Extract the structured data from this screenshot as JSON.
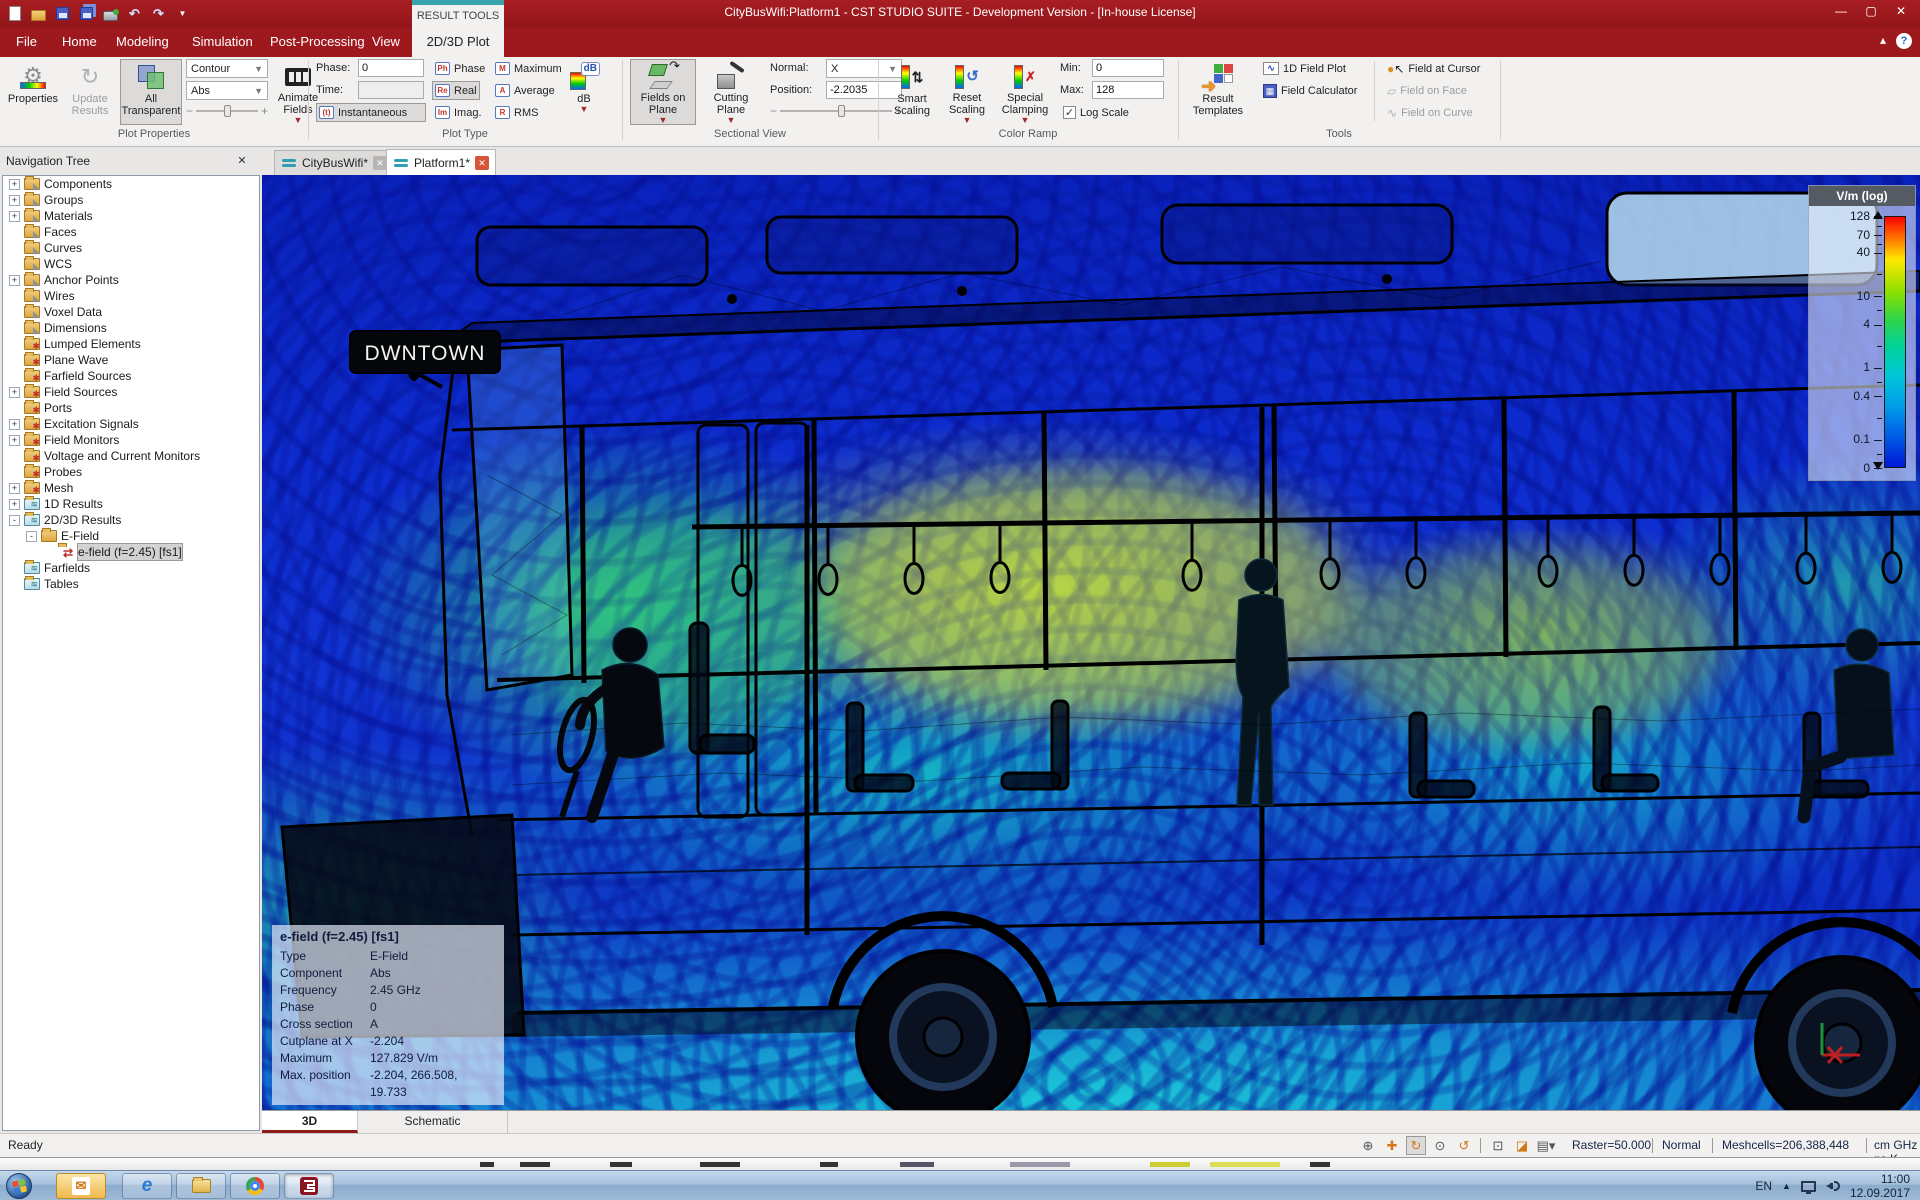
{
  "title_bar": {
    "title": "CityBusWifi:Platform1 - CST STUDIO SUITE - Development Version - [In-house License]",
    "contextual_group": "RESULT TOOLS"
  },
  "ribbon": {
    "tabs": [
      "File",
      "Home",
      "Modeling",
      "Simulation",
      "Post-Processing",
      "View"
    ],
    "contextual_tab": "2D/3D Plot",
    "plot_properties": {
      "label": "Plot Properties",
      "properties": "Properties",
      "update_results": "Update Results",
      "all_transparent": "All Transparent",
      "plot_type_value": "Contour",
      "component_value": "Abs",
      "animate_fields": "Animate Fields"
    },
    "plot_type": {
      "label": "Plot Type",
      "phase_label": "Phase:",
      "phase_value": "0",
      "time_label": "Time:",
      "time_value": "",
      "instantaneous": "Instantaneous",
      "phase_btn": "Phase",
      "real_btn": "Real",
      "imag_btn": "Imag.",
      "maximum_btn": "Maximum",
      "average_btn": "Average",
      "rms_btn": "RMS",
      "db_btn": "dB"
    },
    "sectional_view": {
      "label": "Sectional View",
      "fields_on_plane": "Fields on Plane",
      "cutting_plane": "Cutting Plane",
      "normal_label": "Normal:",
      "normal_value": "X",
      "position_label": "Position:",
      "position_value": "-2.2035"
    },
    "color_ramp": {
      "label": "Color Ramp",
      "smart_scaling": "Smart Scaling",
      "reset_scaling": "Reset Scaling",
      "special_clamping": "Special Clamping",
      "min_label": "Min:",
      "min_value": "0",
      "max_label": "Max:",
      "max_value": "128",
      "log_scale": "Log Scale",
      "log_scale_checked": true
    },
    "tools": {
      "label": "Tools",
      "result_templates": "Result Templates",
      "field_plot_1d": "1D Field Plot",
      "field_calculator": "Field Calculator",
      "field_at_cursor": "Field at Cursor",
      "field_on_face": "Field on Face",
      "field_on_curve": "Field on Curve"
    }
  },
  "document_tabs": [
    {
      "label": "CityBusWifi*",
      "active": false
    },
    {
      "label": "Platform1*",
      "active": true
    }
  ],
  "navigation_tree": {
    "header": "Navigation Tree",
    "items": [
      {
        "label": "Components",
        "depth": 0,
        "exp": "+",
        "icon": "geo"
      },
      {
        "label": "Groups",
        "depth": 0,
        "exp": "+",
        "icon": "geo"
      },
      {
        "label": "Materials",
        "depth": 0,
        "exp": "+",
        "icon": "geo"
      },
      {
        "label": "Faces",
        "depth": 0,
        "exp": null,
        "icon": "geo"
      },
      {
        "label": "Curves",
        "depth": 0,
        "exp": null,
        "icon": "geo"
      },
      {
        "label": "WCS",
        "depth": 0,
        "exp": null,
        "icon": "geo"
      },
      {
        "label": "Anchor Points",
        "depth": 0,
        "exp": "+",
        "icon": "geo"
      },
      {
        "label": "Wires",
        "depth": 0,
        "exp": null,
        "icon": "geo"
      },
      {
        "label": "Voxel Data",
        "depth": 0,
        "exp": null,
        "icon": "geo"
      },
      {
        "label": "Dimensions",
        "depth": 0,
        "exp": null,
        "icon": "geo"
      },
      {
        "label": "Lumped Elements",
        "depth": 0,
        "exp": null,
        "icon": "src"
      },
      {
        "label": "Plane Wave",
        "depth": 0,
        "exp": null,
        "icon": "src"
      },
      {
        "label": "Farfield Sources",
        "depth": 0,
        "exp": null,
        "icon": "src"
      },
      {
        "label": "Field Sources",
        "depth": 0,
        "exp": "+",
        "icon": "src"
      },
      {
        "label": "Ports",
        "depth": 0,
        "exp": null,
        "icon": "src"
      },
      {
        "label": "Excitation Signals",
        "depth": 0,
        "exp": "+",
        "icon": "src"
      },
      {
        "label": "Field Monitors",
        "depth": 0,
        "exp": "+",
        "icon": "src"
      },
      {
        "label": "Voltage and Current Monitors",
        "depth": 0,
        "exp": null,
        "icon": "src"
      },
      {
        "label": "Probes",
        "depth": 0,
        "exp": null,
        "icon": "src"
      },
      {
        "label": "Mesh",
        "depth": 0,
        "exp": "+",
        "icon": "src"
      },
      {
        "label": "1D Results",
        "depth": 0,
        "exp": "+",
        "icon": "res"
      },
      {
        "label": "2D/3D Results",
        "depth": 0,
        "exp": "-",
        "icon": "res"
      },
      {
        "label": "E-Field",
        "depth": 1,
        "exp": "-",
        "icon": "folder"
      },
      {
        "label": "e-field (f=2.45) [fs1]",
        "depth": 2,
        "exp": null,
        "icon": "plot",
        "selected": true
      },
      {
        "label": "Farfields",
        "depth": 0,
        "exp": null,
        "icon": "res"
      },
      {
        "label": "Tables",
        "depth": 0,
        "exp": null,
        "icon": "res"
      }
    ]
  },
  "viewport": {
    "bus_sign": "DWNTOWN",
    "legend": {
      "title": "V/m (log)",
      "ticks": [
        "128",
        "70",
        "40",
        "10",
        "4",
        "1",
        "0.4",
        "0.1",
        "0"
      ]
    },
    "info_box": {
      "title": "e-field (f=2.45) [fs1]",
      "rows": [
        {
          "label": "Type",
          "value": "E-Field"
        },
        {
          "label": "Component",
          "value": "Abs"
        },
        {
          "label": "Frequency",
          "value": "2.45 GHz"
        },
        {
          "label": "Phase",
          "value": "0"
        },
        {
          "label": "Cross section",
          "value": "A"
        },
        {
          "label": "Cutplane at X",
          "value": "-2.204"
        },
        {
          "label": "Maximum",
          "value": "127.829 V/m"
        },
        {
          "label": "Max. position",
          "value": "-2.204,  266.508,  19.733"
        }
      ]
    }
  },
  "view_tabs": [
    {
      "label": "3D",
      "active": true
    },
    {
      "label": "Schematic",
      "active": false
    }
  ],
  "status_bar": {
    "ready": "Ready",
    "raster": "Raster=50.000",
    "render_mode": "Normal",
    "meshcells": "Meshcells=206,388,448",
    "units": "cm  GHz  ns  K"
  },
  "taskbar": {
    "language": "EN",
    "time": "11:00",
    "date": "12.09.2017"
  },
  "colors": {
    "titlebar_red": "#9e191e",
    "contextual_teal": "#39a3ad",
    "legend_header": "#555b63",
    "field_blue": "#0d2fc6",
    "field_green": "#2ecc7a",
    "field_yellow": "#b8dc3c",
    "taskbar_blue": "#a4c0dc"
  }
}
